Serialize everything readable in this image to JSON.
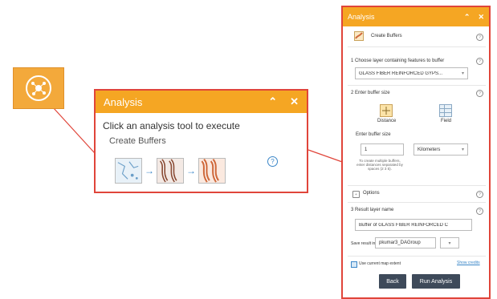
{
  "colors": {
    "accent": "#f5a623",
    "highlight": "#e0453a",
    "arrow": "#e0453a",
    "button": "#3e4a5a",
    "link": "#3a86c8"
  },
  "popup": {
    "title": "Analysis",
    "collapse_icon": "double-chevron-up-icon",
    "close_icon": "close-icon",
    "prompt": "Click an analysis tool to execute",
    "tool_label": "Create Buffers",
    "help_icon": "help-icon"
  },
  "panel": {
    "title": "Analysis",
    "tool_title": "Create Buffers",
    "step1_label": "1 Choose layer containing features to buffer",
    "layer_value": "GLASS FIBER REINFORCED GYPS...",
    "step2_label": "2 Enter buffer size",
    "distance_label": "Distance",
    "field_label": "Field",
    "enter_size_label": "Enter buffer size",
    "size_value": "1",
    "unit_value": "Kilometers",
    "multiple_note": "To create multiple buffers, enter distances separated by spaces (2 3 5).",
    "options_label": "Options",
    "options_toggle": "+",
    "step3_label": "3 Result layer name",
    "result_name": "Buffer of GLASS FIBER REINFORCED C",
    "save_label": "Save result in",
    "save_value": "pkumar3_DAGroup",
    "extent_label": "Use current map extent",
    "show_credits": "Show credits",
    "back_button": "Back",
    "run_button": "Run Analysis"
  }
}
